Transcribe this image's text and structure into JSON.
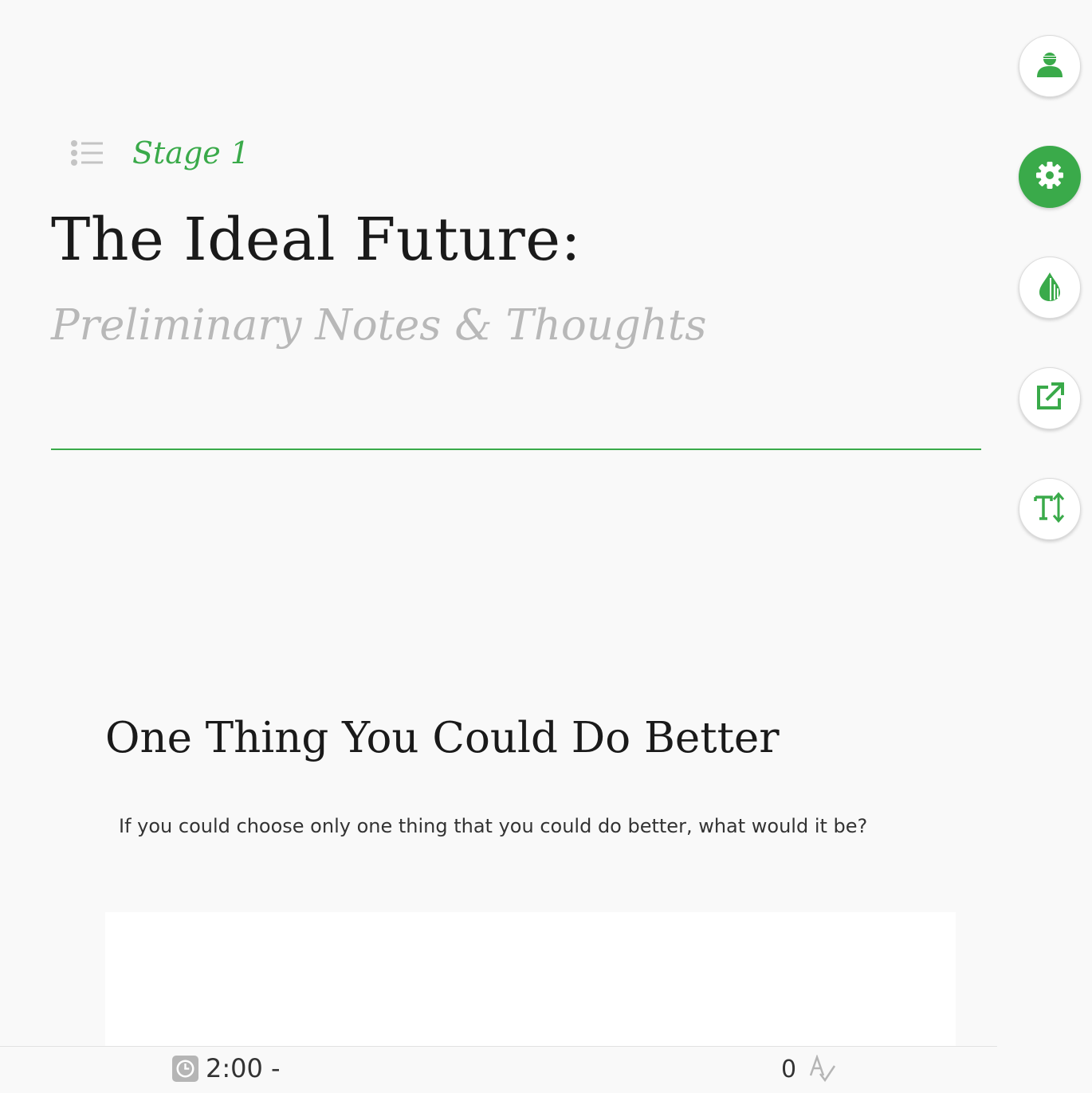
{
  "header": {
    "stage_label": "Stage 1",
    "title": "The Ideal Future:",
    "subtitle": "Preliminary Notes & Thoughts"
  },
  "section": {
    "heading": "One Thing You Could Do Better",
    "prompt": "If you could choose only one thing that you could do better, what would it be?",
    "answer_value": ""
  },
  "footer": {
    "timer": "2:00 -",
    "word_count": "0"
  },
  "sidebar": {
    "buttons": [
      {
        "icon": "user-icon",
        "active": false
      },
      {
        "icon": "gear-icon",
        "active": true
      },
      {
        "icon": "drop-icon",
        "active": false
      },
      {
        "icon": "external-link-icon",
        "active": false
      },
      {
        "icon": "text-size-icon",
        "active": false
      }
    ]
  },
  "colors": {
    "accent": "#3aaa4a",
    "background": "#f9f9f9",
    "title": "#1a1a1a",
    "subtitle": "#b8b8b8"
  }
}
